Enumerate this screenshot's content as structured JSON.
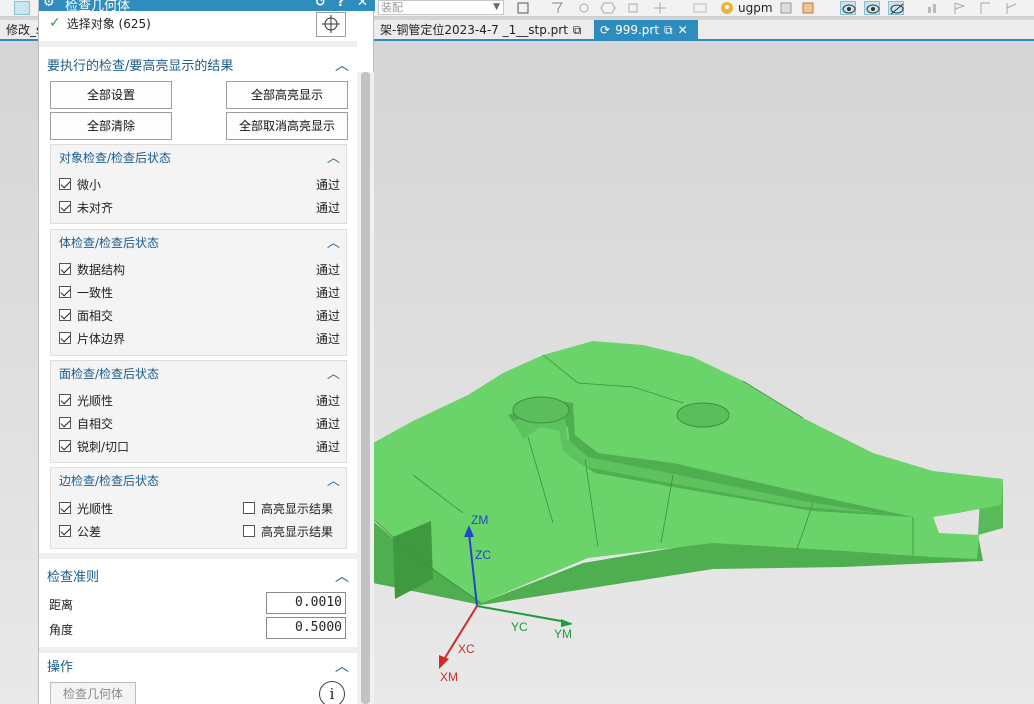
{
  "tabs": [
    {
      "label": "修改_s"
    },
    {
      "label": "架-铜管定位2023-4-7 _1__stp.prt"
    },
    {
      "label": "999.prt",
      "active": true
    }
  ],
  "toolbar": {
    "combo_text": "装配",
    "user_label": "ugpm"
  },
  "dialog": {
    "title": "检查几何体",
    "select_objects_label": "选择对象 (625)",
    "section_checks": "要执行的检查/要高亮显示的结果",
    "buttons": {
      "set_all": "全部设置",
      "highlight_all": "全部高亮显示",
      "clear_all": "全部清除",
      "unhighlight_all": "全部取消高亮显示"
    },
    "groups": [
      {
        "title": "对象检查/检查后状态",
        "items": [
          {
            "label": "微小",
            "result": "通过",
            "checked": true
          },
          {
            "label": "未对齐",
            "result": "通过",
            "checked": true
          }
        ]
      },
      {
        "title": "体检查/检查后状态",
        "items": [
          {
            "label": "数据结构",
            "result": "通过",
            "checked": true
          },
          {
            "label": "一致性",
            "result": "通过",
            "checked": true
          },
          {
            "label": "面相交",
            "result": "通过",
            "checked": true
          },
          {
            "label": "片体边界",
            "result": "通过",
            "checked": true
          }
        ]
      },
      {
        "title": "面检查/检查后状态",
        "items": [
          {
            "label": "光顺性",
            "result": "通过",
            "checked": true
          },
          {
            "label": "自相交",
            "result": "通过",
            "checked": true
          },
          {
            "label": "锐刺/切口",
            "result": "通过",
            "checked": true
          }
        ]
      },
      {
        "title": "边检查/检查后状态",
        "items": [
          {
            "label": "光顺性",
            "highlight_label": "高亮显示结果",
            "checked": true,
            "highlight_checked": false
          },
          {
            "label": "公差",
            "highlight_label": "高亮显示结果",
            "checked": true,
            "highlight_checked": false
          }
        ]
      }
    ],
    "criteria": {
      "title": "检查准则",
      "distance_label": "距离",
      "distance_value": "0.0010",
      "angle_label": "角度",
      "angle_value": "0.5000"
    },
    "operations": {
      "title": "操作",
      "check_button": "检查几何体"
    }
  },
  "triad": {
    "zm": "ZM",
    "zc": "ZC",
    "yc": "YC",
    "ym": "YM",
    "xc": "XC",
    "xm": "XM"
  },
  "colors": {
    "accent": "#2f8dbd",
    "part_green": "#6ad46a",
    "section_text": "#1c5c8c",
    "axis_z": "#2346c8",
    "axis_y": "#1f9a3c",
    "axis_x": "#cc2b2b"
  }
}
